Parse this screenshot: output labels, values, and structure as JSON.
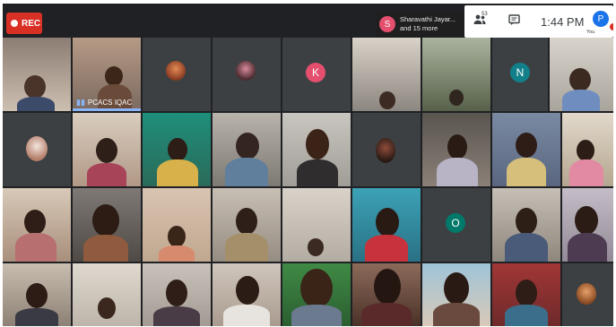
{
  "recording": {
    "label": "REC"
  },
  "presenter": {
    "initial": "S",
    "line1": "Sharavathi Jayar...",
    "line2": "and 15 more"
  },
  "controls": {
    "people_count": "53",
    "time": "1:44 PM",
    "user_initial": "P",
    "user_label": "You"
  },
  "avatars": {
    "k_initial": "K",
    "n_initial": "N",
    "o_initial": "O"
  },
  "active_speaker": {
    "name": "PCACS IQAC"
  },
  "colors": {
    "rec": "#d93025",
    "k_avatar": "#e34f6d",
    "n_avatar": "#12808a",
    "o_avatar": "#00796b",
    "you_avatar": "#1a73e8"
  }
}
